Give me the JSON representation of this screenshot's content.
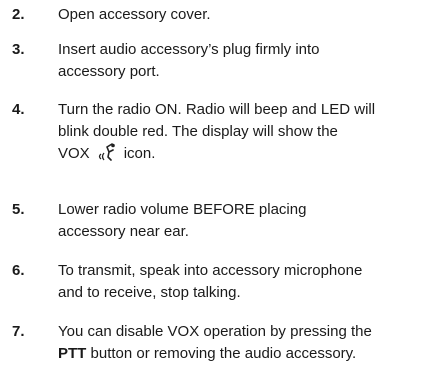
{
  "steps": [
    {
      "number": "2.",
      "lines": [
        "Open accessory cover."
      ]
    },
    {
      "number": "3.",
      "lines": [
        "Insert audio accessory’s plug firmly into",
        "accessory port."
      ]
    },
    {
      "number": "4.",
      "lines": [
        "Turn the radio ON. Radio will beep and LED will",
        "blink double red. The display will show the"
      ],
      "vox_prefix": "VOX",
      "vox_icon": "vox-icon",
      "vox_suffix": "icon."
    },
    {
      "number": "5.",
      "lines": [
        "Lower radio volume BEFORE placing",
        "accessory near ear."
      ]
    },
    {
      "number": "6.",
      "lines": [
        "To transmit, speak into accessory microphone",
        "and to receive, stop talking."
      ]
    },
    {
      "number": "7.",
      "lines": [
        "You can disable VOX operation by pressing the"
      ],
      "ptt_bold": "PTT",
      "ptt_rest": " button or removing the audio accessory."
    }
  ]
}
